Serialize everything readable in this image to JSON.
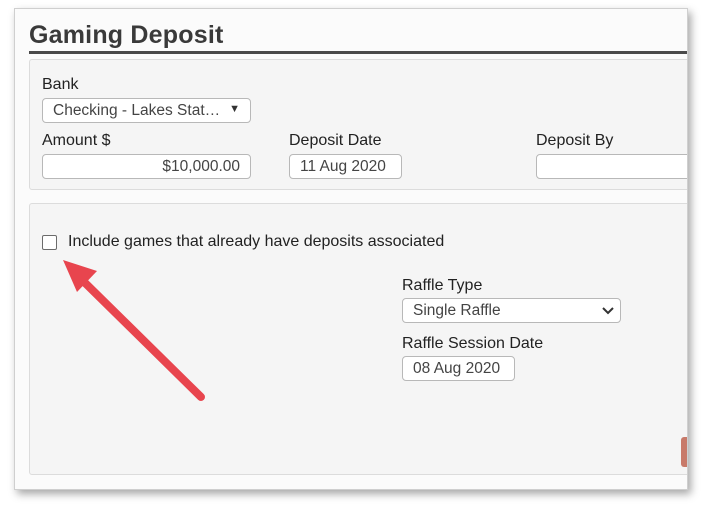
{
  "page": {
    "title": "Gaming Deposit"
  },
  "deposit_form": {
    "bank_label": "Bank",
    "bank_value": "Checking - Lakes State Bank",
    "bank_display": "Checking - Lakes Stat…",
    "amount_label": "Amount $",
    "amount_value": "$10,000.00",
    "deposit_date_label": "Deposit Date",
    "deposit_date_value": "11 Aug 2020",
    "deposit_by_label": "Deposit By",
    "deposit_by_value": ""
  },
  "filters": {
    "include_games_label": "Include games that already have deposits associated",
    "include_games_checked": false,
    "raffle_type_label": "Raffle Type",
    "raffle_type_value": "Single Raffle",
    "raffle_session_date_label": "Raffle Session Date",
    "raffle_session_date_value": "08 Aug 2020"
  },
  "annotation": {
    "arrow_color": "#e8454e",
    "points_to": "include-games-checkbox"
  },
  "icons": {
    "select_caret": "caret-down-icon",
    "select_chevron": "chevron-down-icon"
  },
  "colors": {
    "title_text": "#3a3a3a",
    "panel_background": "#f5f5f5",
    "field_border": "#b8b8b8"
  }
}
